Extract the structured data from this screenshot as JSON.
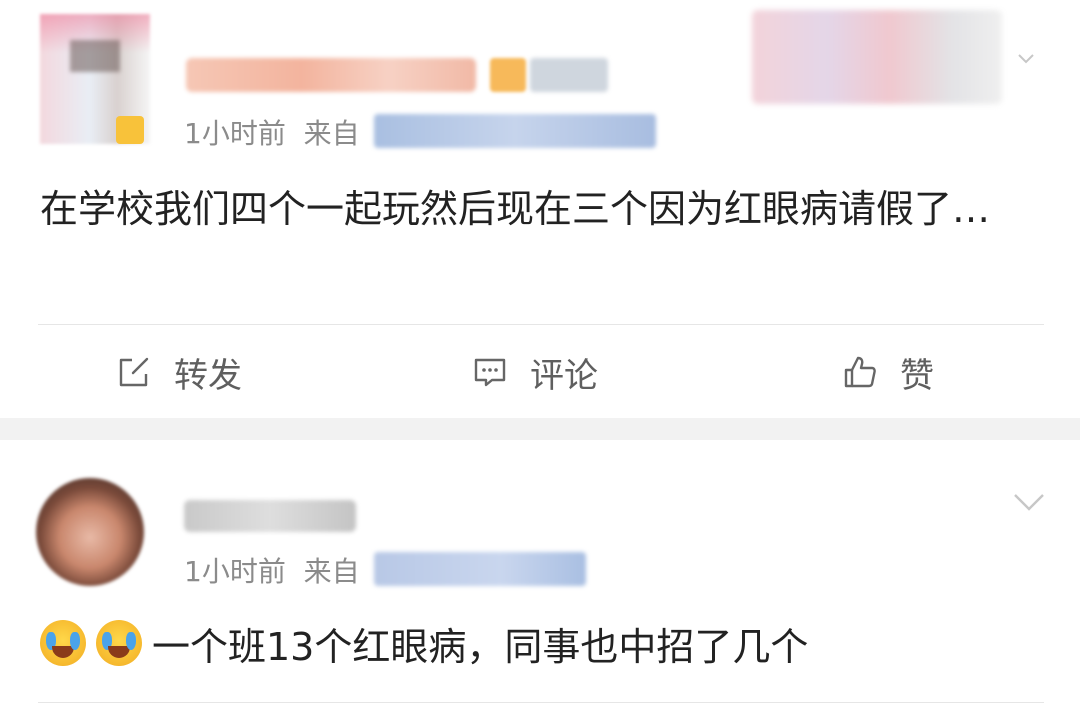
{
  "posts": [
    {
      "time": "1小时前",
      "source_prefix": "来自",
      "text": "在学校我们四个一起玩然后现在三个因为红眼病请假了…",
      "actions": {
        "repost": "转发",
        "comment": "评论",
        "like": "赞"
      }
    },
    {
      "time": "1小时前",
      "source_prefix": "来自",
      "emojis": [
        "crying-laughing-emoji",
        "crying-laughing-emoji"
      ],
      "text": "一个班13个红眼病，同事也中招了几个"
    }
  ],
  "icons": {
    "repost": "edit-share-icon",
    "comment": "comment-bubble-icon",
    "like": "thumbs-up-icon",
    "more": "chevron-down-icon"
  },
  "colors": {
    "meta_text": "#8b8b8b",
    "action_text": "#5f5f5f",
    "separator": "#f2f2f2"
  }
}
